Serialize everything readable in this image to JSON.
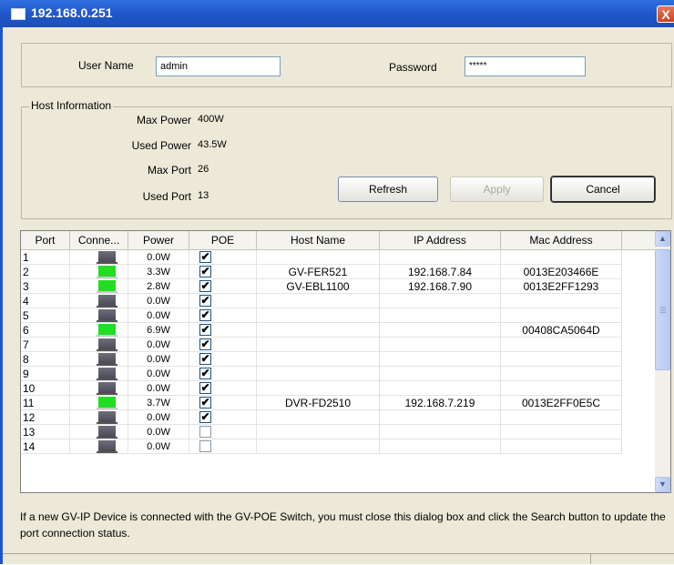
{
  "window": {
    "title": "192.168.0.251",
    "close_glyph": "X"
  },
  "login": {
    "user_label": "User Name",
    "user_value": "admin",
    "password_label": "Password",
    "password_value": "*****"
  },
  "host": {
    "legend": "Host Information",
    "fields": [
      {
        "label": "Max Power",
        "value": "400W"
      },
      {
        "label": "Used Power",
        "value": "43.5W"
      },
      {
        "label": "Max Port",
        "value": "26"
      },
      {
        "label": "Used Port",
        "value": "13"
      }
    ]
  },
  "buttons": {
    "refresh": "Refresh",
    "apply": "Apply",
    "cancel": "Cancel"
  },
  "table": {
    "columns": [
      "Port",
      "Conne...",
      "Power",
      "POE",
      "Host Name",
      "IP Address",
      "Mac Address"
    ],
    "rows": [
      {
        "port": "1",
        "connected": false,
        "power": "0.0W",
        "poe": true,
        "host": "",
        "ip": "",
        "mac": ""
      },
      {
        "port": "2",
        "connected": true,
        "power": "3.3W",
        "poe": true,
        "host": "GV-FER521",
        "ip": "192.168.7.84",
        "mac": "0013E203466E"
      },
      {
        "port": "3",
        "connected": true,
        "power": "2.8W",
        "poe": true,
        "host": "GV-EBL1100",
        "ip": "192.168.7.90",
        "mac": "0013E2FF1293"
      },
      {
        "port": "4",
        "connected": false,
        "power": "0.0W",
        "poe": true,
        "host": "",
        "ip": "",
        "mac": ""
      },
      {
        "port": "5",
        "connected": false,
        "power": "0.0W",
        "poe": true,
        "host": "",
        "ip": "",
        "mac": ""
      },
      {
        "port": "6",
        "connected": true,
        "power": "6.9W",
        "poe": true,
        "host": "",
        "ip": "",
        "mac": "00408CA5064D"
      },
      {
        "port": "7",
        "connected": false,
        "power": "0.0W",
        "poe": true,
        "host": "",
        "ip": "",
        "mac": ""
      },
      {
        "port": "8",
        "connected": false,
        "power": "0.0W",
        "poe": true,
        "host": "",
        "ip": "",
        "mac": ""
      },
      {
        "port": "9",
        "connected": false,
        "power": "0.0W",
        "poe": true,
        "host": "",
        "ip": "",
        "mac": ""
      },
      {
        "port": "10",
        "connected": false,
        "power": "0.0W",
        "poe": true,
        "host": "",
        "ip": "",
        "mac": ""
      },
      {
        "port": "11",
        "connected": true,
        "power": "3.7W",
        "poe": true,
        "host": "DVR-FD2510",
        "ip": "192.168.7.219",
        "mac": "0013E2FF0E5C"
      },
      {
        "port": "12",
        "connected": false,
        "power": "0.0W",
        "poe": true,
        "host": "",
        "ip": "",
        "mac": ""
      },
      {
        "port": "13",
        "connected": false,
        "power": "0.0W",
        "poe": false,
        "host": "",
        "ip": "",
        "mac": ""
      },
      {
        "port": "14",
        "connected": false,
        "power": "0.0W",
        "poe": false,
        "host": "",
        "ip": "",
        "mac": ""
      }
    ]
  },
  "note": "If a new GV-IP Device is connected with the GV-POE Switch, you must close this dialog box and click the Search button to update the port connection status.",
  "icons": {
    "check": "✔",
    "scroll_up": "▲",
    "scroll_down": "▼"
  },
  "colors": {
    "connected": "#22dd22",
    "disconnected": "#4a4a58",
    "title_bar": "#1f55c7"
  }
}
